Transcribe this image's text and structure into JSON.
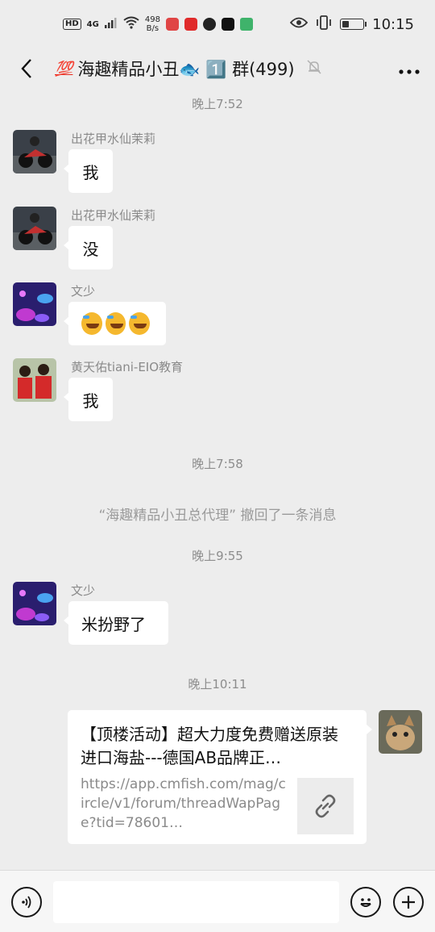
{
  "status_bar": {
    "hd": "HD",
    "network": "4G",
    "speed_value": "498",
    "speed_unit": "B/s",
    "time": "10:15",
    "battery_level": 0.35
  },
  "header": {
    "badge": "💯",
    "title": "海趣精品小丑🐟 1️⃣ 群(499)"
  },
  "messages": [
    {
      "sender": "出花甲水仙茉莉",
      "text": "我"
    },
    {
      "sender": "出花甲水仙茉莉",
      "text": "没"
    },
    {
      "sender": "文少",
      "text": ""
    },
    {
      "sender": "黄天佑tiani-EIO教育",
      "text": "我"
    },
    {
      "sender": "文少",
      "text": "米扮野了"
    }
  ],
  "timestamps": [
    "晚上7:52",
    "晚上7:58",
    "晚上9:55",
    "晚上10:11"
  ],
  "system_notice": "“海趣精品小丑总代理” 撤回了一条消息",
  "link_card": {
    "title": "【顶楼活动】超大力度免费赠送原装进口海盐---德国AB品牌正…",
    "desc": "https://app.cmfish.com/mag/circle/v1/forum/threadWapPage?tid=78601…"
  },
  "input_bar": {
    "placeholder": ""
  },
  "colors": {
    "background": "#ededed",
    "bubble": "#ffffff",
    "muted_text": "#8a8a8a"
  }
}
